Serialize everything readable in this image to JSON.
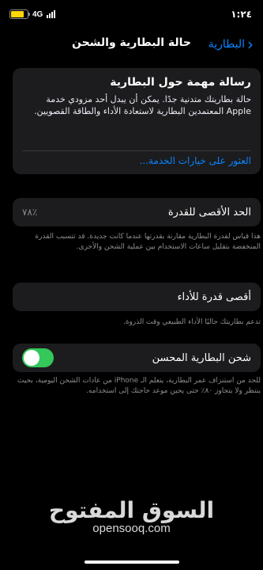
{
  "status_bar": {
    "time": "١:٢٤",
    "network": "4G",
    "battery_level": 0.78,
    "battery_color": "#ffd60a"
  },
  "nav": {
    "back_label": "البطارية",
    "title": "حالة البطارية والشحن",
    "back_icon": "chevron-right-icon"
  },
  "message_card": {
    "title": "رسالة مهمة حول البطارية",
    "body": "حالة بطاريتك متدنية جدًا. يمكن أن يبدل أحد مزودي خدمة Apple المعتمدين البطارية لاستعادة الأداء والطاقة القصويين.",
    "link": "العثور على خيارات الخدمة..."
  },
  "capacity": {
    "label": "الحد الأقصى للقدرة",
    "value": "٪٧٨",
    "note": "هذا قياس لقدرة البطارية مقارنة بقدرتها عندما كانت جديدة. قد تتسبب القدرة المنخفضة بتقليل ساعات الاستخدام بين عملية الشحن والأخرى."
  },
  "performance": {
    "label": "أقصى قدرة للأداء",
    "note": "تدعم بطاريتك حاليًا الأداء الطبيعي وقت الذروة."
  },
  "optimized_charging": {
    "label": "شحن البطارية المحسن",
    "enabled": true,
    "toggle_color": "#34c759",
    "note": "للحد من استنزاف عمر البطارية، يتعلم الـ iPhone من عادات الشحن اليومية، بحيث ينتظر ولا يتجاوز ٨٠٪ حتى يحين موعد حاجتك إلى استخدامه."
  },
  "watermark": {
    "arabic": "السوق المفتوح",
    "latin": "opensooq.com"
  },
  "colors": {
    "accent": "#0a84ff",
    "card_bg": "#1c1c1e",
    "secondary_text": "#8e8e93"
  }
}
